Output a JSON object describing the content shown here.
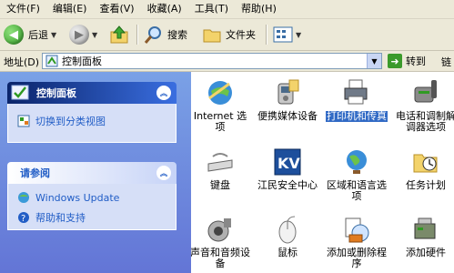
{
  "menubar": [
    "文件(F)",
    "编辑(E)",
    "查看(V)",
    "收藏(A)",
    "工具(T)",
    "帮助(H)"
  ],
  "toolbar": {
    "back": "后退",
    "search": "搜索",
    "folders": "文件夹"
  },
  "address": {
    "label": "地址(D)",
    "value": "控制面板",
    "go": "转到",
    "links": "链"
  },
  "panel": {
    "cp_title": "控制面板",
    "switch_view": "切换到分类视图",
    "see_also": "请参阅",
    "windows_update": "Windows Update",
    "help": "帮助和支持"
  },
  "items": [
    "Internet 选项",
    "便携媒体设备",
    "打印机和传真",
    "电话和调制解调器选项",
    "键盘",
    "江民安全中心",
    "区域和语言选项",
    "任务计划",
    "声音和音频设备",
    "鼠标",
    "添加或删除程序",
    "添加硬件"
  ]
}
